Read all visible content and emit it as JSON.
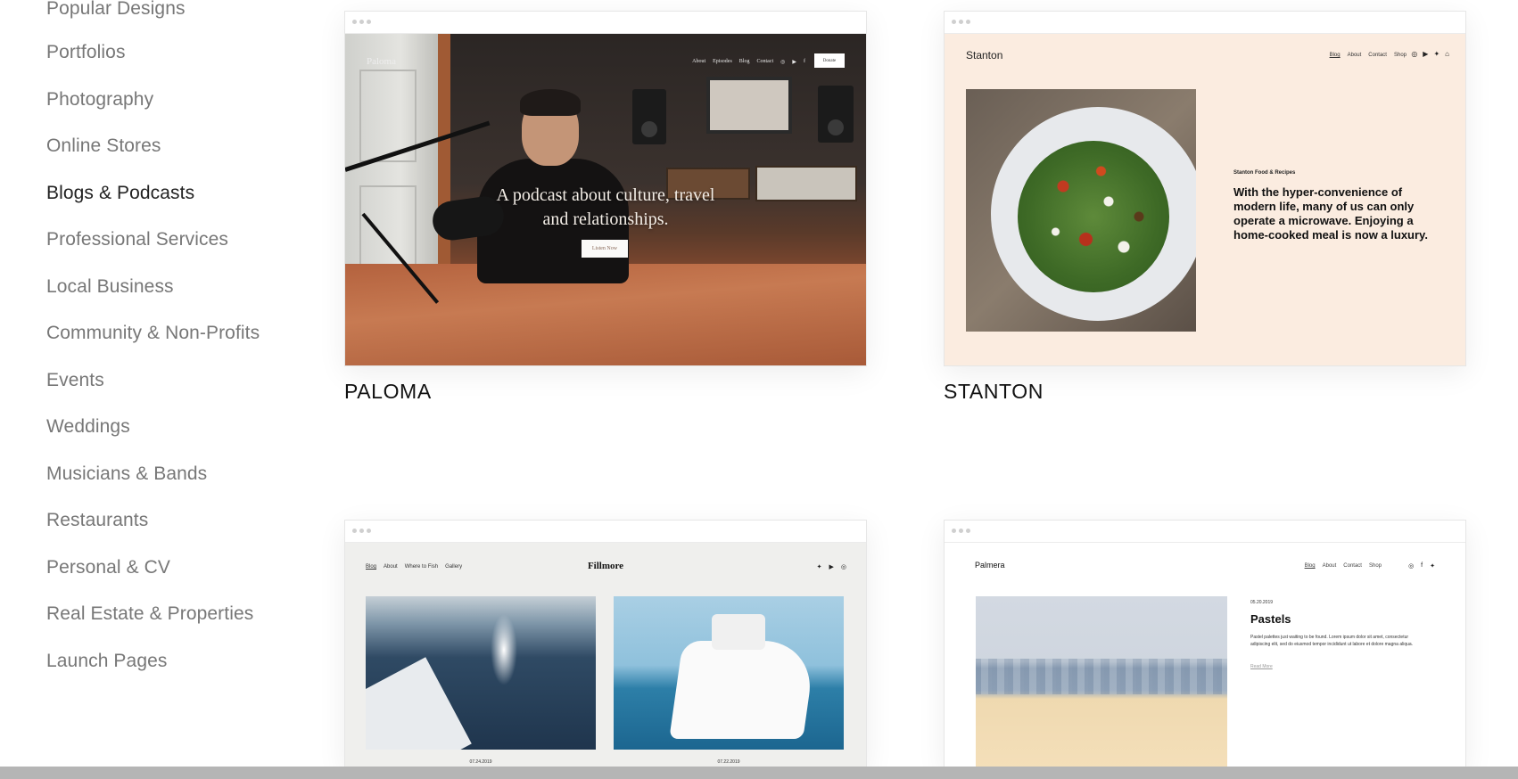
{
  "sidebar": {
    "items": [
      {
        "label": "Popular Designs",
        "active": false
      },
      {
        "label": "Portfolios",
        "active": false
      },
      {
        "label": "Photography",
        "active": false
      },
      {
        "label": "Online Stores",
        "active": false
      },
      {
        "label": "Blogs & Podcasts",
        "active": true
      },
      {
        "label": "Professional Services",
        "active": false
      },
      {
        "label": "Local Business",
        "active": false
      },
      {
        "label": "Community & Non-Profits",
        "active": false
      },
      {
        "label": "Events",
        "active": false
      },
      {
        "label": "Weddings",
        "active": false
      },
      {
        "label": "Musicians & Bands",
        "active": false
      },
      {
        "label": "Restaurants",
        "active": false
      },
      {
        "label": "Personal & CV",
        "active": false
      },
      {
        "label": "Real Estate & Properties",
        "active": false
      },
      {
        "label": "Launch Pages",
        "active": false
      }
    ]
  },
  "templates": {
    "paloma": {
      "name": "PALOMA",
      "logo": "Paloma",
      "nav": [
        "About",
        "Episodes",
        "Blog",
        "Contact"
      ],
      "social": [
        "instagram-icon",
        "youtube-icon",
        "facebook-icon"
      ],
      "donate_label": "Donate",
      "hero_line1": "A podcast about culture, travel",
      "hero_line2": "and relationships.",
      "cta_label": "Listen Now"
    },
    "stanton": {
      "name": "STANTON",
      "logo": "Stanton",
      "nav": [
        "Blog",
        "About",
        "Contact",
        "Shop"
      ],
      "social": [
        "instagram-icon",
        "youtube-icon",
        "twitter-icon",
        "cart-icon"
      ],
      "eyebrow": "Stanton Food & Recipes",
      "headline": "With the hyper-convenience of modern life, many of us can only operate a microwave. Enjoying a home-cooked meal is now a luxury."
    },
    "fillmore": {
      "logo": "Fillmore",
      "nav": [
        "Blog",
        "About",
        "Where to Fish",
        "Gallery"
      ],
      "social": [
        "twitter-icon",
        "youtube-icon",
        "instagram-icon"
      ],
      "date1": "07.24.2019",
      "date2": "07.22.2019"
    },
    "palmera": {
      "logo": "Palmera",
      "nav": [
        "Blog",
        "About",
        "Contact",
        "Shop"
      ],
      "social": [
        "instagram-icon",
        "facebook-icon",
        "twitter-icon"
      ],
      "post_date": "05.20.2019",
      "post_title": "Pastels",
      "post_body": "Pastel palettes just waiting to be found. Lorem ipsum dolor sit amet, consectetur adipiscing elit, sed do eiusmod tempor incididunt ut labore et dolore magna aliqua.",
      "read_more": "Read More"
    }
  },
  "icons": {
    "instagram": "◎",
    "youtube": "▶",
    "facebook": "f",
    "twitter": "✦",
    "cart": "⌂"
  },
  "colors": {
    "sidebar_inactive": "#777777",
    "sidebar_active": "#222222",
    "stanton_bg": "#fbece0",
    "fillmore_bg": "#efefed"
  }
}
